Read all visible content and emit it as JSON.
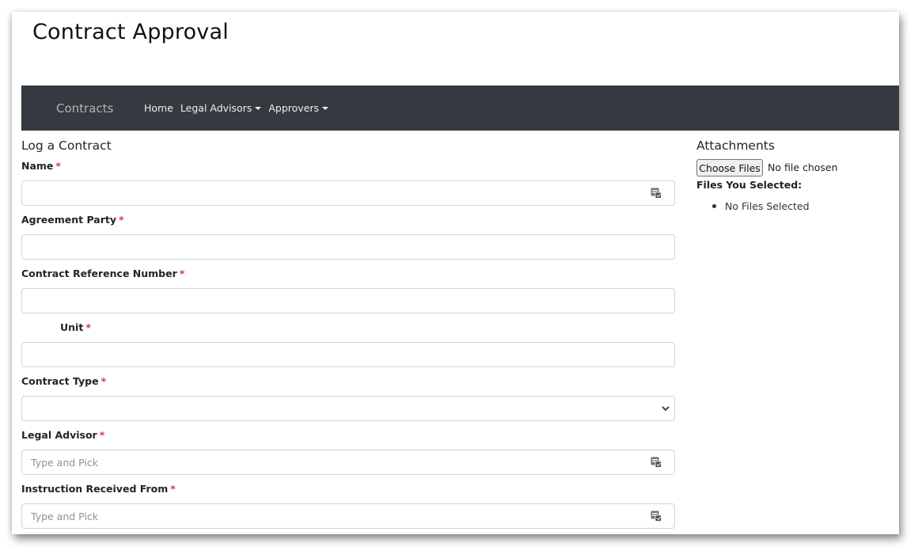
{
  "app": {
    "title": "Contract Approval"
  },
  "navbar": {
    "brand": "Contracts",
    "links": [
      {
        "label": "Home",
        "dropdown": false
      },
      {
        "label": "Legal Advisors",
        "dropdown": true
      },
      {
        "label": "Approvers",
        "dropdown": true
      }
    ]
  },
  "form": {
    "title": "Log a Contract",
    "required_marker": "*",
    "fields": {
      "name": {
        "label": "Name",
        "value": "",
        "icon": "people-picker-icon"
      },
      "agreement_party": {
        "label": "Agreement Party",
        "value": ""
      },
      "reference_number": {
        "label": "Contract Reference Number",
        "value": ""
      },
      "unit": {
        "label": "Unit",
        "value": ""
      },
      "contract_type": {
        "label": "Contract Type",
        "value": ""
      },
      "legal_advisor": {
        "label": "Legal Advisor",
        "placeholder": "Type and Pick",
        "icon": "people-picker-icon"
      },
      "instruction_from": {
        "label": "Instruction Received From",
        "placeholder": "Type and Pick",
        "icon": "people-picker-icon"
      }
    }
  },
  "attachments": {
    "title": "Attachments",
    "choose_button": "Choose Files",
    "status": "No file chosen",
    "selected_label": "Files You Selected:",
    "selected_files": [
      "No Files Selected"
    ]
  },
  "colors": {
    "navbar_bg": "#343a40",
    "required": "#dc3545",
    "input_border": "#ced4da"
  }
}
